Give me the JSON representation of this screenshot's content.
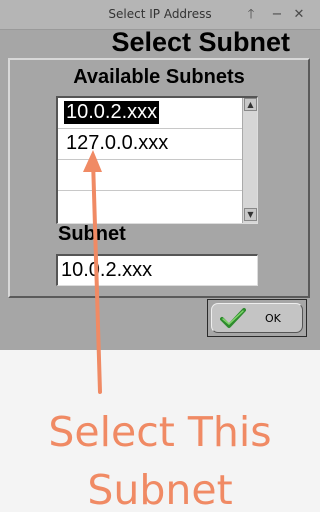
{
  "window": {
    "title": "Select IP Address",
    "btn_pin": "🡑",
    "btn_min": "−",
    "btn_close": "✕"
  },
  "dialog": {
    "heading": "Select Subnet",
    "list_heading": "Available Subnets",
    "subnets": [
      "10.0.2.xxx",
      "127.0.0.xxx"
    ],
    "selected_index": 0,
    "subnet_label": "Subnet",
    "subnet_value": "10.0.2.xxx",
    "ok_label": "OK"
  },
  "annotation": {
    "line1": "Select This",
    "line2": "Subnet",
    "color": "#f08a64"
  },
  "icons": {
    "ok": "green-checkmark-icon",
    "scroll_up": "triangle-up",
    "scroll_down": "triangle-down"
  }
}
